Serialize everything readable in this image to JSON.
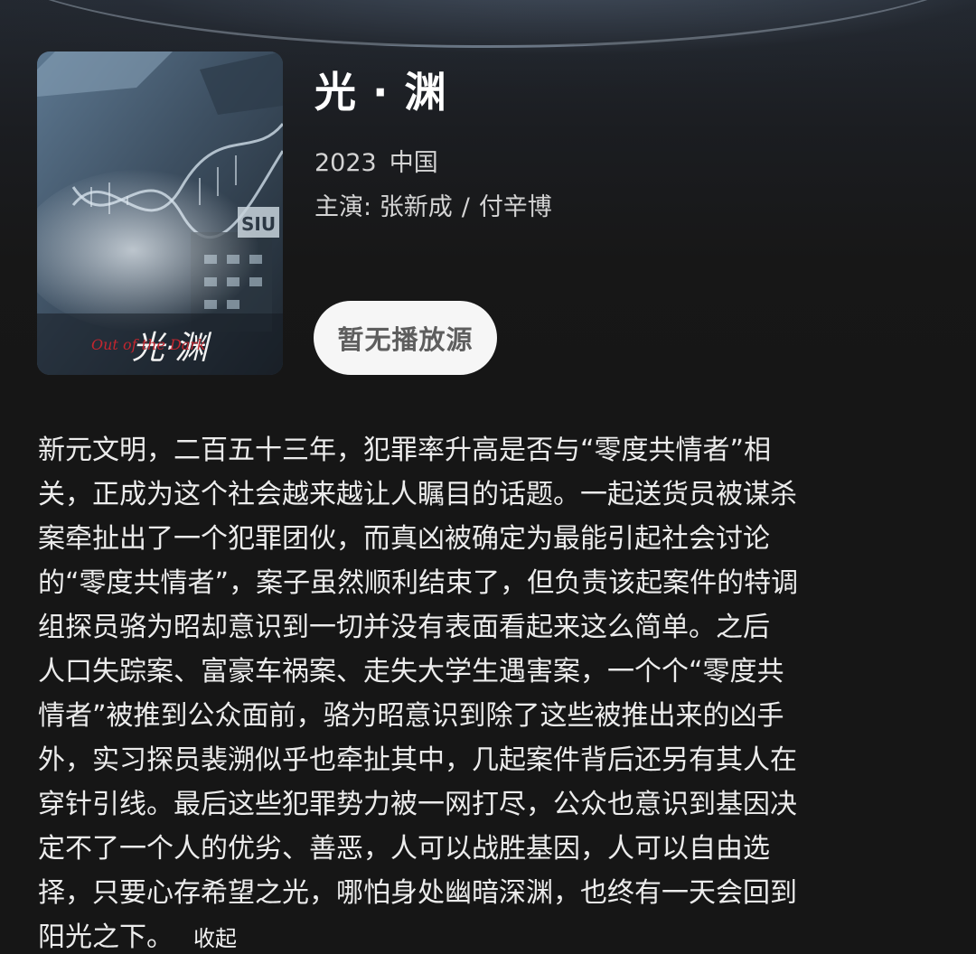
{
  "movie": {
    "title": "光 · 渊",
    "year": "2023",
    "country": "中国",
    "cast_label": "主演:",
    "cast": [
      "张新成",
      "付辛博"
    ],
    "cast_separator": "/",
    "play_button_label": "暂无播放源",
    "poster": {
      "title_text": "光·渊",
      "subtitle_text": "Out of the Dark",
      "sign_text": "SIU"
    }
  },
  "synopsis": {
    "lines": [
      "新元文明，二百五十三年，犯罪率升高是否与“零度共情者”相",
      "关，正成为这个社会越来越让人瞩目的话题。一起送货员被谋杀",
      "案牵扯出了一个犯罪团伙，而真凶被确定为最能引起社会讨论",
      "的“零度共情者”，案子虽然顺利结束了，但负责该起案件的特调",
      "组探员骆为昭却意识到一切并没有表面看起来这么简单。之后",
      "人口失踪案、富豪车祸案、走失大学生遇害案，一个个“零度共",
      "情者”被推到公众面前，骆为昭意识到除了这些被推出来的凶手",
      "外，实习探员裴溯似乎也牵扯其中，几起案件背后还另有其人在",
      "穿针引线。最后这些犯罪势力被一网打尽，公众也意识到基因决",
      "定不了一个人的优劣、善恶，人可以战胜基因，人可以自由选",
      "择，只要心存希望之光，哪怕身处幽暗深渊，也终有一天会回到",
      "阳光之下。"
    ],
    "collapse_label": "收起"
  }
}
